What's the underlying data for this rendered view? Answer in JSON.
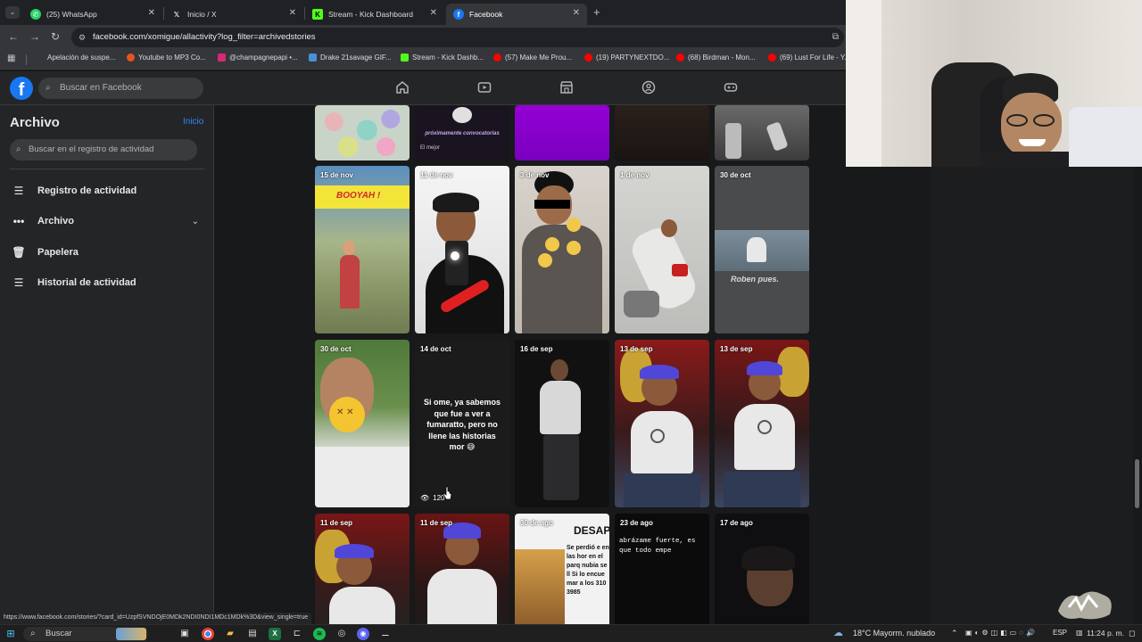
{
  "browser": {
    "tabs": [
      {
        "label": "(25) WhatsApp",
        "icon": "whatsapp-icon"
      },
      {
        "label": "Inicio / X",
        "icon": "x-icon"
      },
      {
        "label": "Stream - Kick Dashboard",
        "icon": "kick-icon"
      },
      {
        "label": "Facebook",
        "icon": "facebook-icon",
        "active": true
      }
    ],
    "new_tab": "+",
    "url": "facebook.com/xomigue/allactivity?log_filter=archivedstories",
    "bookmarks": [
      "Apelación de suspe...",
      "Youtube to MP3 Co...",
      "@champagnepapi •...",
      "Drake 21savage GIF...",
      "Stream - Kick Dashb...",
      "(57) Make Me Prou...",
      "(19) PARTYNEXTDO...",
      "(68) Birdman - Mon...",
      "(69) Lust For Life - Y..."
    ]
  },
  "facebook": {
    "logo": "f",
    "search_placeholder": "Buscar en Facebook"
  },
  "sidebar": {
    "title": "Archivo",
    "home_link": "Inicio",
    "search_placeholder": "Buscar en el registro de actividad",
    "items": [
      {
        "label": "Registro de actividad",
        "icon": "list-icon"
      },
      {
        "label": "Archivo",
        "icon": "more-icon"
      },
      {
        "label": "Papelera",
        "icon": "trash-icon"
      },
      {
        "label": "Historial de actividad",
        "icon": "list-icon"
      }
    ]
  },
  "stories": {
    "row0": [
      {
        "date": "",
        "text": "próximamente convocatorias",
        "text2": "El mejor"
      },
      {
        "date": ""
      },
      {
        "date": ""
      },
      {
        "date": ""
      },
      {
        "date": ""
      }
    ],
    "row1": [
      {
        "date": "15 de nov",
        "text": "BOOYAH !"
      },
      {
        "date": "11 de nov"
      },
      {
        "date": "3 de nov"
      },
      {
        "date": "1 de nov"
      },
      {
        "date": "30 de oct",
        "text": "Roben pues."
      }
    ],
    "row2": [
      {
        "date": "30 de oct"
      },
      {
        "date": "14 de oct",
        "text": "Si ome, ya sabemos que fue a ver a fumaratto, pero no llene las historias mor 😅",
        "views": "120"
      },
      {
        "date": "16 de sep"
      },
      {
        "date": "13 de sep"
      },
      {
        "date": "13 de sep"
      }
    ],
    "row3": [
      {
        "date": "11 de sep"
      },
      {
        "date": "11 de sep"
      },
      {
        "date": "30 de ago",
        "text": "DESAP",
        "text2": "Se perdió e en las hor en el parq nubia se ll Si lo encue mar a los 310 3985"
      },
      {
        "date": "23 de ago",
        "text": "abrázame fuerte, es que todo empe"
      },
      {
        "date": "17 de ago"
      }
    ]
  },
  "status_url": "https://www.facebook.com/stories/?card_id=UzpfSVNDOjE0MDk2NDI0NDI1MDc1MDk%3D&view_single=true",
  "taskbar": {
    "search": "Buscar",
    "weather": "18°C  Mayorm. nublado",
    "lang": "ESP",
    "time": "11:24 p. m."
  }
}
